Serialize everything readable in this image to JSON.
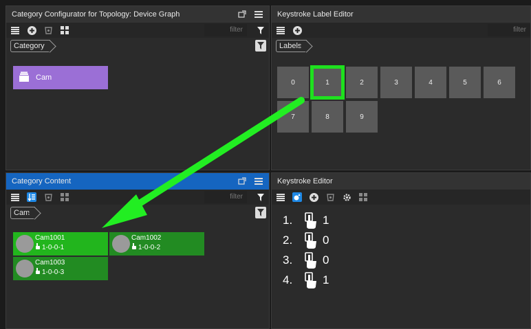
{
  "top_left": {
    "title": "Category Configurator for Topology: Device Graph",
    "filter_placeholder": "filter",
    "breadcrumb": "Category",
    "category_tile": "Cam"
  },
  "top_right": {
    "title": "Keystroke Label Editor",
    "filter_placeholder": "filter",
    "breadcrumb": "Labels",
    "keys": [
      "0",
      "1",
      "2",
      "3",
      "4",
      "5",
      "6",
      "7",
      "8",
      "9"
    ],
    "selected_key": "1"
  },
  "bottom_left": {
    "title": "Category Content",
    "filter_placeholder": "filter",
    "breadcrumb": "Cam",
    "items": [
      {
        "name": "Cam1001",
        "address": "1-0-0-1"
      },
      {
        "name": "Cam1002",
        "address": "1-0-0-2"
      },
      {
        "name": "Cam1003",
        "address": "1-0-0-3"
      }
    ]
  },
  "bottom_right": {
    "title": "Keystroke Editor",
    "steps": [
      {
        "num": "1.",
        "value": "1"
      },
      {
        "num": "2.",
        "value": "0"
      },
      {
        "num": "3.",
        "value": "0"
      },
      {
        "num": "4.",
        "value": "1"
      }
    ]
  },
  "colors": {
    "category_tile": "#9b6fd6",
    "content_tile": "#228b22",
    "content_tile_selected": "#22b51d",
    "selection_outline": "#1ee01e",
    "blue_header": "#1565c0",
    "arrow": "#22ee22"
  }
}
